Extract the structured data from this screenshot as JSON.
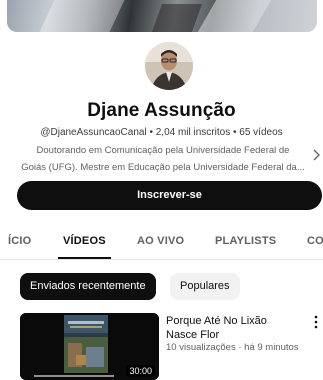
{
  "channel": {
    "name": "Djane Assunção",
    "handle": "@DjaneAssuncaoCanal",
    "subscribers": "2,04 mil inscritos",
    "videos_count": "65 vídeos",
    "separator": " • ",
    "description_lines": [
      "Doutorando em Comunicação pela Universidade Federal de",
      "Goiás (UFG). Mestre em Educação pela Universidade Federal da..."
    ],
    "subscribe_label": "Inscrever-se"
  },
  "tabs": [
    {
      "label": "ÍCIO",
      "active": false
    },
    {
      "label": "VÍDEOS",
      "active": true
    },
    {
      "label": "AO VIVO",
      "active": false
    },
    {
      "label": "PLAYLISTS",
      "active": false
    },
    {
      "label": "CO",
      "active": false
    }
  ],
  "chips": [
    {
      "label": "Enviados recentemente",
      "selected": true
    },
    {
      "label": "Populares",
      "selected": false
    }
  ],
  "videos": [
    {
      "title_lines": [
        "Porque Até No Lixão",
        "Nasce Flor"
      ],
      "meta": "10 visualizações · há 9 minutos",
      "duration": "30:00"
    }
  ],
  "icons": {
    "description_arrow": "chevron-right-icon",
    "video_menu": "more-vertical-icon"
  },
  "colors": {
    "primary": "#0f0f0f",
    "secondary_text": "#606060",
    "chip_bg": "#f2f2f2"
  }
}
